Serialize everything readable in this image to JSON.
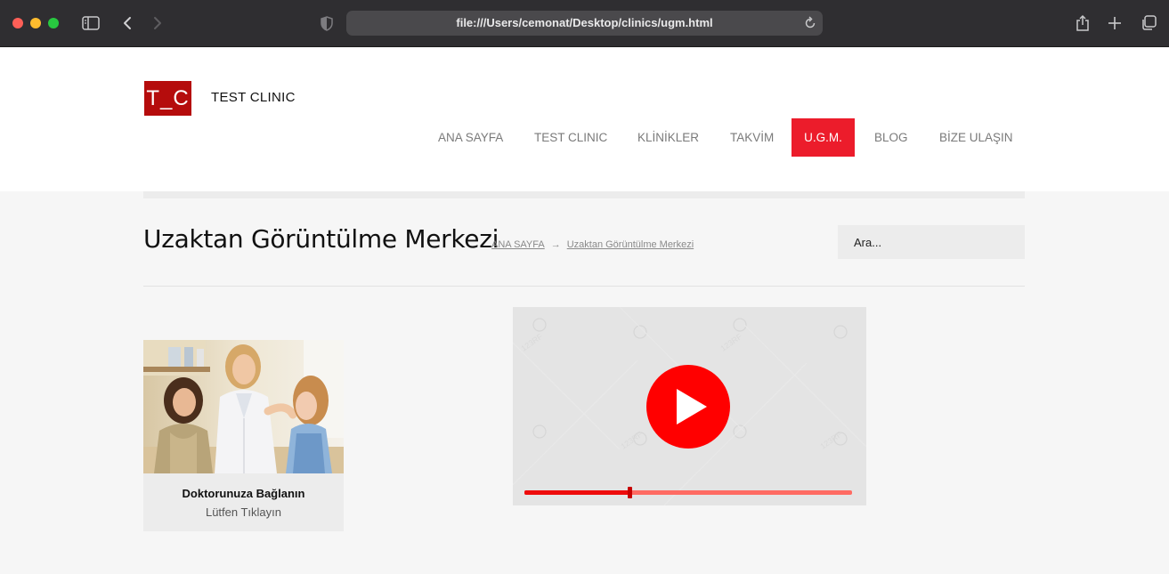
{
  "browser": {
    "url": "file:///Users/cemonat/Desktop/clinics/ugm.html"
  },
  "header": {
    "logo_text": "T_C",
    "site_name": "TEST CLINIC",
    "nav": [
      {
        "label": "ANA SAYFA"
      },
      {
        "label": "TEST CLINIC"
      },
      {
        "label": "KLİNİKLER"
      },
      {
        "label": "TAKVİM"
      },
      {
        "label": "U.G.M.",
        "active": true
      },
      {
        "label": "BLOG"
      },
      {
        "label": "BİZE ULAŞIN"
      }
    ],
    "accent_color": "#ec1c2b",
    "logo_color": "#b50c0c"
  },
  "page": {
    "title": "Uzaktan Görüntülme Merkezi",
    "breadcrumb": {
      "home": "ANA SAYFA",
      "separator": "→",
      "current": "Uzaktan Görüntülme Merkezi"
    },
    "search_placeholder": "Ara..."
  },
  "card": {
    "title": "Doktorunuza Bağlanın",
    "subtitle": "Lütfen Tıklayın"
  },
  "video": {
    "progress": 0.32,
    "play_color": "#ff0000"
  }
}
